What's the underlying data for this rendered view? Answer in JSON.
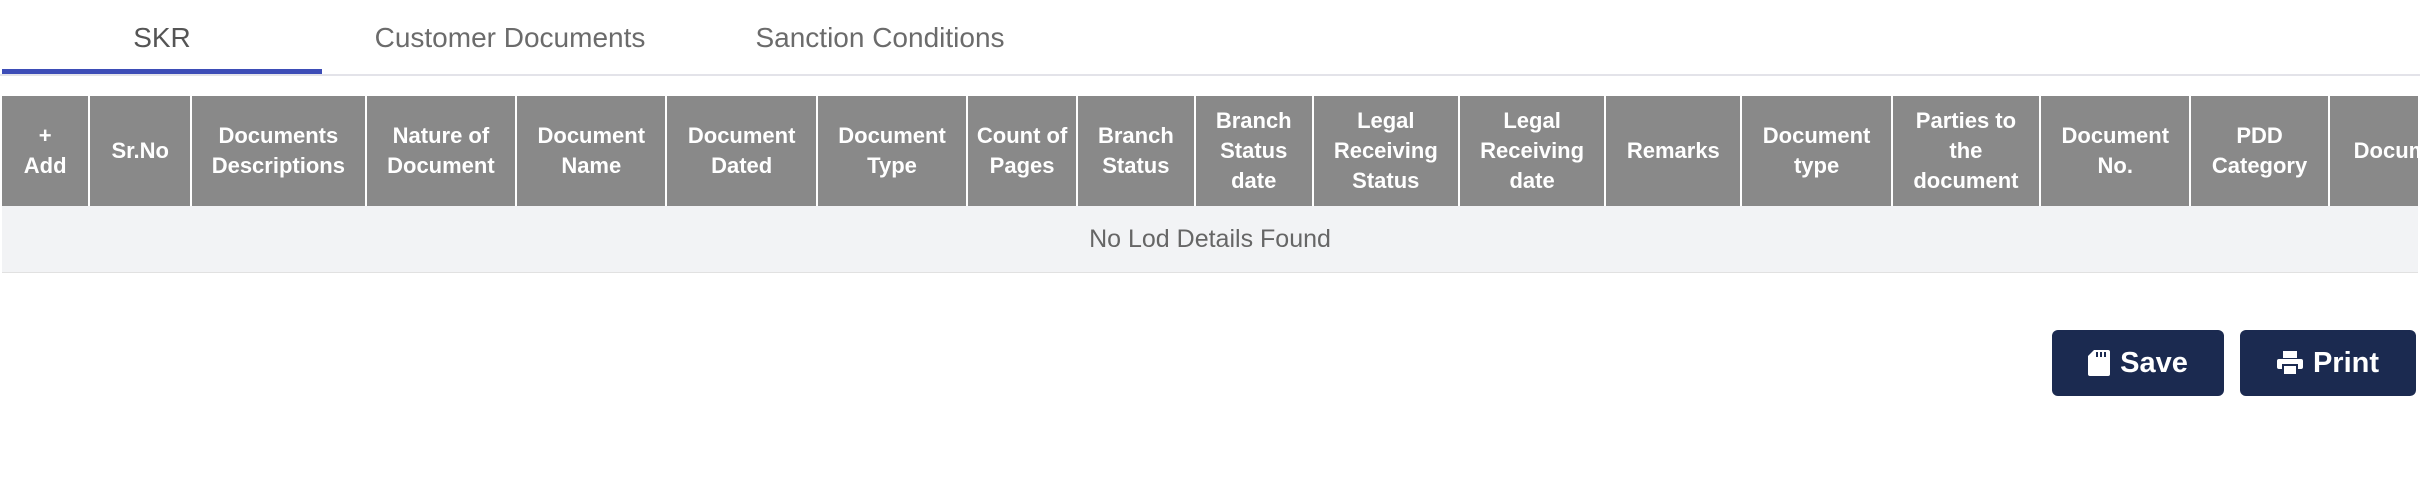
{
  "tabs": [
    {
      "label": "SKR",
      "active": true
    },
    {
      "label": "Customer Documents",
      "active": false
    },
    {
      "label": "Sanction Conditions",
      "active": false
    }
  ],
  "table": {
    "add_plus": "+",
    "add_label": "Add",
    "columns": [
      "Sr.No",
      "Documents Descriptions",
      "Nature of Document",
      "Document Name",
      "Document Dated",
      "Document Type",
      "Count of Pages",
      "Branch Status",
      "Branch Status date",
      "Legal Receiving Status",
      "Legal Receiving date",
      "Remarks",
      "Document type",
      "Parties to the document",
      "Document No.",
      "PDD Category",
      "Document"
    ],
    "empty_message": "No Lod Details Found"
  },
  "actions": {
    "save_label": "Save",
    "print_label": "Print",
    "save_icon": "sd-card-icon",
    "print_icon": "printer-icon"
  },
  "colors": {
    "header_bg": "#898989",
    "tab_underline": "#3d4db7",
    "button_bg": "#1b2a50"
  }
}
